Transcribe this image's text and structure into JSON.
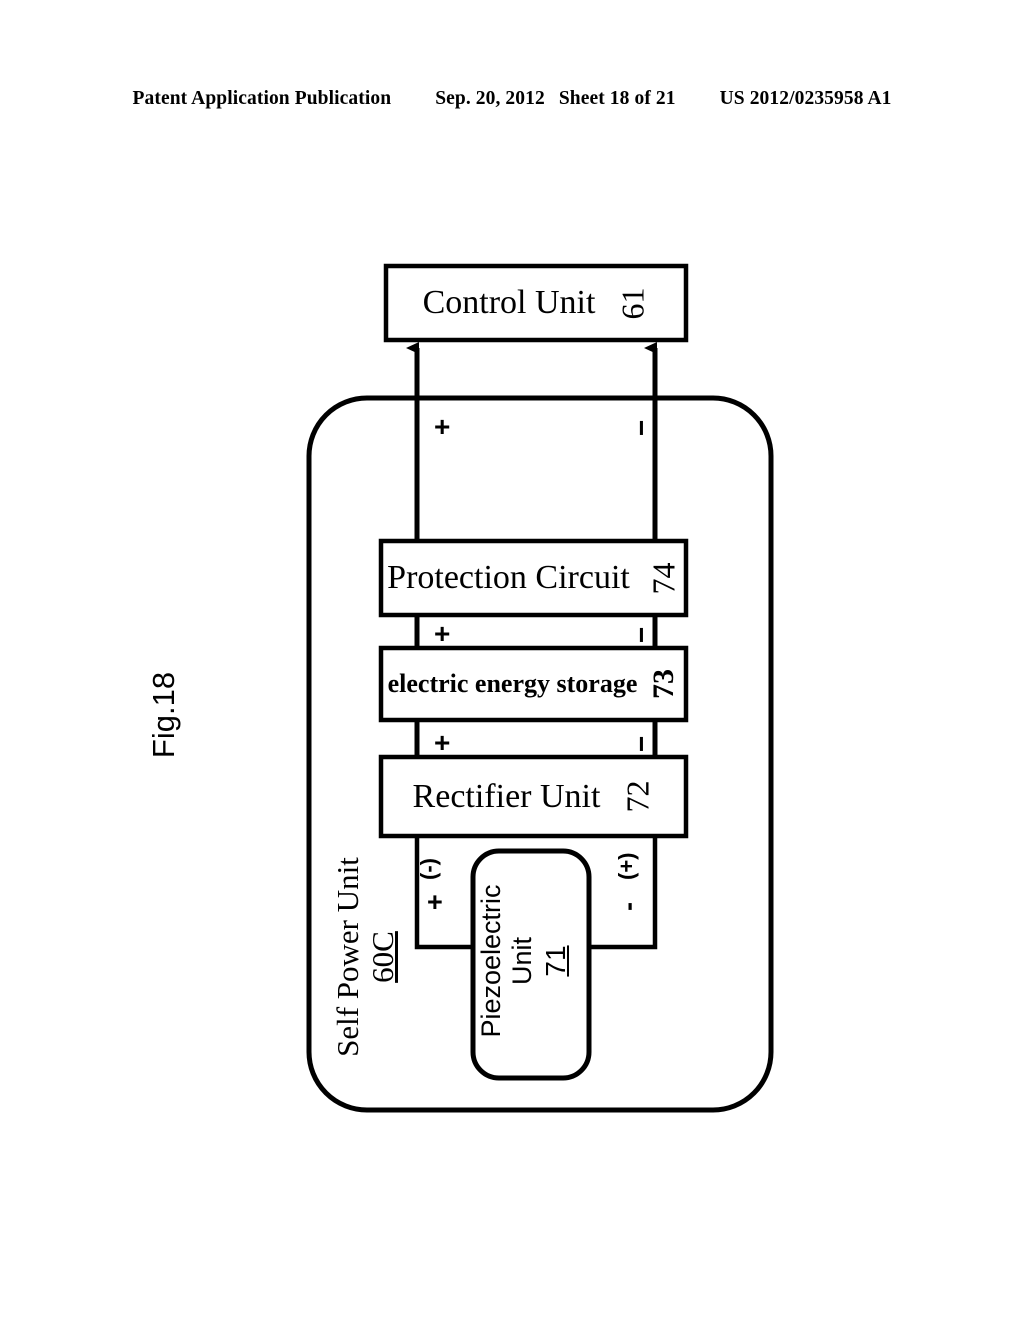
{
  "header": {
    "publication": "Patent Application Publication",
    "date": "Sep. 20, 2012",
    "sheet": "Sheet 18 of 21",
    "patent_number": "US 2012/0235958 A1"
  },
  "figure": {
    "label": "Fig.18"
  },
  "diagram": {
    "outer_container": {
      "title_line1": "Self Power Unit",
      "title_line2": "60C"
    },
    "blocks": [
      {
        "id": "control-unit",
        "label": "Control Unit",
        "ref": "61",
        "style": "serif",
        "shape": "rect"
      },
      {
        "id": "protection-circuit",
        "label": "Protection Circuit",
        "ref": "74",
        "style": "serif",
        "shape": "rect"
      },
      {
        "id": "electric-energy-storage",
        "label": "electric energy storage",
        "ref": "73",
        "style": "bold",
        "shape": "rect"
      },
      {
        "id": "rectifier-unit",
        "label": "Rectifier Unit",
        "ref": "72",
        "style": "serif",
        "shape": "rect"
      },
      {
        "id": "piezoelectric-unit",
        "label_line1": "Piezoelectric",
        "label_line2": "Unit",
        "ref": "71",
        "style": "sans",
        "shape": "rounded-rect"
      }
    ],
    "polarity_markers": {
      "control_left": "+",
      "control_right": "−",
      "protection_left": "+",
      "protection_right": "−",
      "storage_left": "+",
      "storage_right": "−",
      "piezo_left_paren": "(-)",
      "piezo_left_sign": "+",
      "piezo_right_paren": "(+)",
      "piezo_right_sign": "-"
    },
    "colors": {
      "ink": "#000000",
      "background": "#ffffff"
    }
  }
}
